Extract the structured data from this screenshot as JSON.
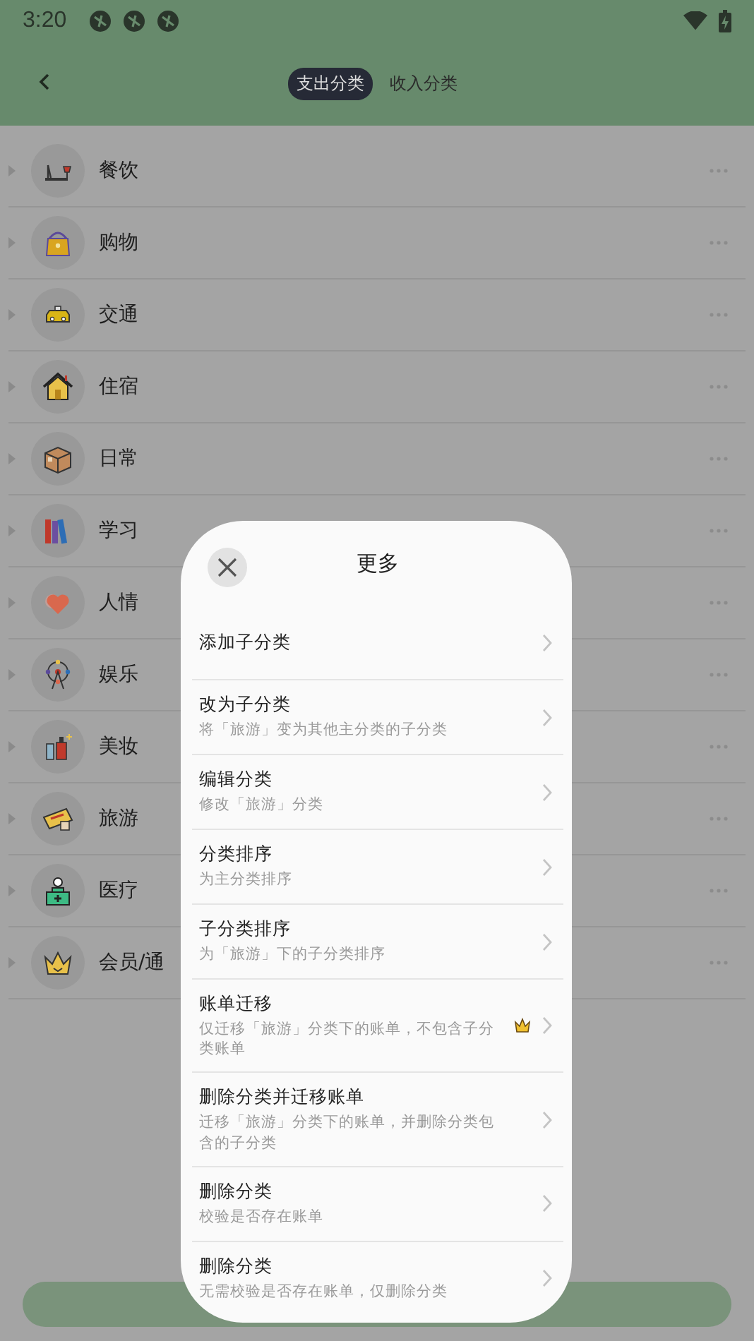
{
  "status_bar": {
    "time": "3:20"
  },
  "header": {
    "tabs": [
      {
        "label": "支出分类",
        "selected": true
      },
      {
        "label": "收入分类",
        "selected": false
      }
    ]
  },
  "categories": [
    {
      "name": "餐饮"
    },
    {
      "name": "购物"
    },
    {
      "name": "交通"
    },
    {
      "name": "住宿"
    },
    {
      "name": "日常"
    },
    {
      "name": "学习"
    },
    {
      "name": "人情"
    },
    {
      "name": "娱乐"
    },
    {
      "name": "美妆"
    },
    {
      "name": "旅游"
    },
    {
      "name": "医疗"
    },
    {
      "name": "会员/通"
    }
  ],
  "sheet": {
    "title": "更多",
    "items": [
      {
        "title": "添加子分类",
        "vip": false
      },
      {
        "title": "改为子分类",
        "subtitle": "将「旅游」变为其他主分类的子分类",
        "vip": false
      },
      {
        "title": "编辑分类",
        "subtitle": "修改「旅游」分类",
        "vip": false
      },
      {
        "title": "分类排序",
        "subtitle": "为主分类排序",
        "vip": false
      },
      {
        "title": "子分类排序",
        "subtitle": "为「旅游」下的子分类排序",
        "vip": false
      },
      {
        "title": "账单迁移",
        "subtitle": "仅迁移「旅游」分类下的账单，不包含子分类账单",
        "vip": true
      },
      {
        "title": "删除分类并迁移账单",
        "subtitle": "迁移「旅游」分类下的账单，并删除分类包含的子分类",
        "vip": false
      },
      {
        "title": "删除分类",
        "subtitle": "校验是否存在账单",
        "vip": false
      },
      {
        "title": "删除分类",
        "subtitle": "无需校验是否存在账单，仅删除分类",
        "vip": false
      }
    ]
  }
}
